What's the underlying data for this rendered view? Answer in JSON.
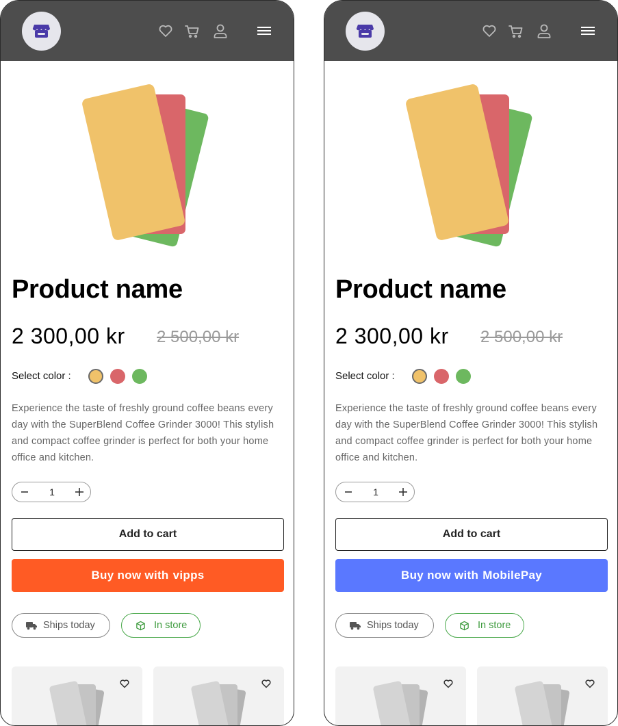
{
  "screens": [
    {
      "product_name": "Product name",
      "price": "2 300,00 kr",
      "old_price": "2 500,00 kr",
      "select_color_label": "Select color :",
      "colors": [
        "#f0c26a",
        "#d9666a",
        "#6db85f"
      ],
      "description": "Experience the taste of freshly ground coffee beans every day with the SuperBlend Coffee Grinder 3000! This stylish and compact coffee grinder is perfect for both your home office and kitchen.",
      "quantity": "1",
      "add_to_cart_label": "Add to cart",
      "buy_now_prefix": "Buy now with",
      "buy_now_brand": "vipps",
      "buy_now_color": "#ff5b24",
      "ships_today_label": "Ships today",
      "in_store_label": "In store"
    },
    {
      "product_name": "Product name",
      "price": "2 300,00 kr",
      "old_price": "2 500,00 kr",
      "select_color_label": "Select color :",
      "colors": [
        "#f0c26a",
        "#d9666a",
        "#6db85f"
      ],
      "description": "Experience the taste of freshly ground coffee beans every day with the SuperBlend Coffee Grinder 3000! This stylish and compact coffee grinder is perfect for both your home office and kitchen.",
      "quantity": "1",
      "add_to_cart_label": "Add to cart",
      "buy_now_prefix": "Buy now with",
      "buy_now_brand": "MobilePay",
      "buy_now_color": "#5a78ff",
      "ships_today_label": "Ships today",
      "in_store_label": "In store"
    }
  ],
  "header_icons": [
    "store-logo-icon",
    "heart-icon",
    "cart-icon",
    "user-icon",
    "menu-icon"
  ],
  "header_color": "#4d4d4d",
  "in_store_color": "#49a84a"
}
